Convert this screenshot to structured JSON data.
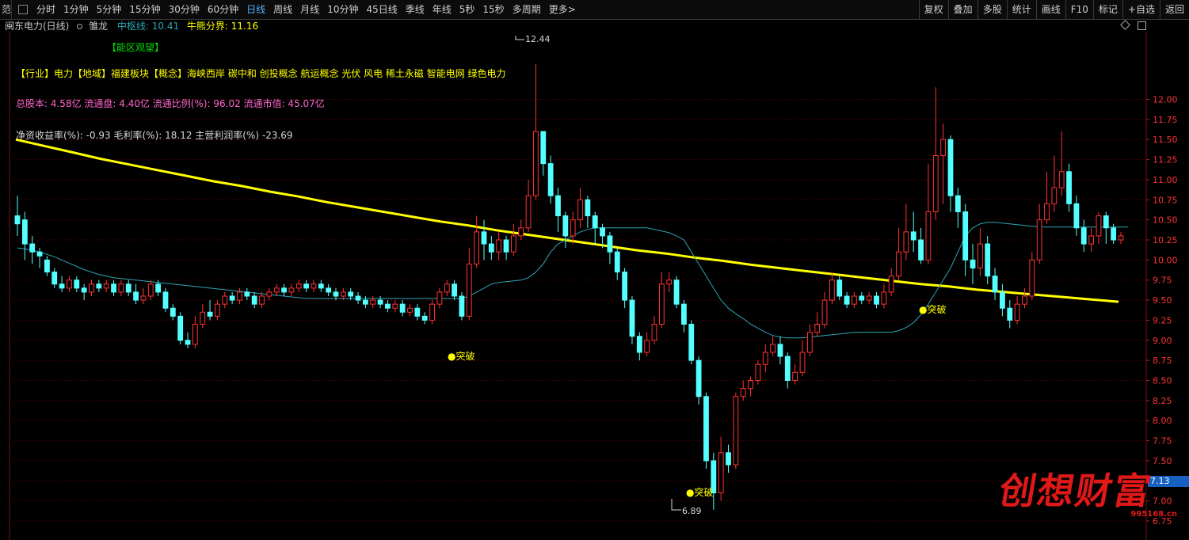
{
  "toolbar": {
    "corner": "范",
    "tabs": [
      "分时",
      "1分钟",
      "5分钟",
      "15分钟",
      "30分钟",
      "60分钟",
      "日线",
      "周线",
      "月线",
      "10分钟",
      "45日线",
      "季线",
      "年线",
      "5秒",
      "15秒",
      "多周期",
      "更多>"
    ],
    "active_tab": "日线",
    "right_buttons": [
      "复权",
      "叠加",
      "多股",
      "统计",
      "画线",
      "F10",
      "标记",
      "+自选",
      "返回"
    ]
  },
  "info": {
    "stock": "闽东电力(日线)",
    "indicator": "雏龙",
    "mid_line": "中枢线: 10.41",
    "bull_bear": "牛熊分界: 11.16"
  },
  "annotations": {
    "energy_zone": "【能区观望】",
    "industry": "【行业】电力【地域】福建板块【概念】海峡西岸 碳中和 创投概念 航运概念 光伏 风电 稀土永磁 智能电网 绿色电力",
    "capital": "总股本: 4.58亿 流通盘: 4.40亿 流通比例(%): 96.02 流通市值: 45.07亿",
    "finance": "净资收益率(%): -0.93 毛利率(%): 18.12 主营利润率(%) -23.69",
    "breakouts": [
      "●突破",
      "●突破",
      "●突破"
    ],
    "high_label": "12.44",
    "low_label": "6.89"
  },
  "last_price": "7.13",
  "watermark": {
    "title": "创想财富",
    "url": "995168.cn"
  },
  "colors": {
    "up": "#ff3232",
    "down": "#54ffff",
    "ma": "#2aa6b4",
    "bull_line": "#ffff00",
    "grid": "#7a0000"
  },
  "chart_data": {
    "type": "candlestick",
    "ylim": [
      6.75,
      12.35
    ],
    "yticks": [
      "12.00",
      "11.75",
      "11.50",
      "11.25",
      "11.00",
      "10.75",
      "10.50",
      "10.25",
      "10.00",
      "9.75",
      "9.50",
      "9.25",
      "9.00",
      "8.75",
      "8.50",
      "8.25",
      "8.00",
      "7.75",
      "7.50",
      "7.25",
      "7.00",
      "6.75"
    ],
    "bull_bear_line": [
      11.5,
      11.42,
      11.34,
      11.26,
      11.19,
      11.12,
      11.05,
      10.98,
      10.92,
      10.85,
      10.79,
      10.72,
      10.66,
      10.6,
      10.54,
      10.48,
      10.43,
      10.37,
      10.32,
      10.27,
      10.22,
      10.17,
      10.12,
      10.08,
      10.03,
      9.99,
      9.94,
      9.9,
      9.86,
      9.82,
      9.78,
      9.74,
      9.7,
      9.67,
      9.63,
      9.6,
      9.57,
      9.54,
      9.51,
      9.48
    ],
    "candles": [
      [
        10.55,
        10.45,
        10.8,
        10.3
      ],
      [
        10.5,
        10.2,
        10.6,
        10.0
      ],
      [
        10.2,
        10.1,
        10.3,
        9.95
      ],
      [
        10.1,
        10.05,
        10.15,
        9.9
      ],
      [
        10.0,
        9.85,
        10.05,
        9.8
      ],
      [
        9.85,
        9.7,
        9.9,
        9.65
      ],
      [
        9.7,
        9.65,
        9.8,
        9.6
      ],
      [
        9.65,
        9.75,
        9.8,
        9.6
      ],
      [
        9.75,
        9.65,
        9.8,
        9.6
      ],
      [
        9.65,
        9.6,
        9.7,
        9.5
      ],
      [
        9.6,
        9.7,
        9.75,
        9.55
      ],
      [
        9.7,
        9.65,
        9.75,
        9.6
      ],
      [
        9.65,
        9.7,
        9.75,
        9.6
      ],
      [
        9.7,
        9.6,
        9.75,
        9.55
      ],
      [
        9.6,
        9.7,
        9.75,
        9.55
      ],
      [
        9.7,
        9.6,
        9.75,
        9.55
      ],
      [
        9.6,
        9.5,
        9.7,
        9.45
      ],
      [
        9.5,
        9.55,
        9.65,
        9.45
      ],
      [
        9.55,
        9.7,
        9.75,
        9.5
      ],
      [
        9.7,
        9.6,
        9.75,
        9.55
      ],
      [
        9.6,
        9.4,
        9.65,
        9.35
      ],
      [
        9.4,
        9.3,
        9.45,
        9.25
      ],
      [
        9.3,
        9.0,
        9.35,
        8.95
      ],
      [
        9.0,
        8.95,
        9.1,
        8.9
      ],
      [
        8.95,
        9.2,
        9.3,
        8.9
      ],
      [
        9.2,
        9.35,
        9.45,
        9.15
      ],
      [
        9.35,
        9.3,
        9.5,
        9.25
      ],
      [
        9.3,
        9.45,
        9.5,
        9.25
      ],
      [
        9.45,
        9.55,
        9.6,
        9.4
      ],
      [
        9.55,
        9.5,
        9.6,
        9.45
      ],
      [
        9.5,
        9.6,
        9.65,
        9.45
      ],
      [
        9.6,
        9.55,
        9.65,
        9.5
      ],
      [
        9.55,
        9.45,
        9.6,
        9.4
      ],
      [
        9.45,
        9.55,
        9.6,
        9.4
      ],
      [
        9.55,
        9.6,
        9.65,
        9.5
      ],
      [
        9.6,
        9.65,
        9.7,
        9.55
      ],
      [
        9.65,
        9.6,
        9.7,
        9.55
      ],
      [
        9.6,
        9.65,
        9.7,
        9.55
      ],
      [
        9.65,
        9.7,
        9.75,
        9.6
      ],
      [
        9.7,
        9.65,
        9.75,
        9.6
      ],
      [
        9.65,
        9.7,
        9.75,
        9.6
      ],
      [
        9.7,
        9.65,
        9.75,
        9.6
      ],
      [
        9.65,
        9.6,
        9.7,
        9.55
      ],
      [
        9.6,
        9.55,
        9.65,
        9.5
      ],
      [
        9.55,
        9.6,
        9.65,
        9.5
      ],
      [
        9.6,
        9.55,
        9.65,
        9.5
      ],
      [
        9.55,
        9.5,
        9.6,
        9.45
      ],
      [
        9.5,
        9.45,
        9.55,
        9.4
      ],
      [
        9.45,
        9.5,
        9.55,
        9.4
      ],
      [
        9.5,
        9.45,
        9.55,
        9.4
      ],
      [
        9.45,
        9.4,
        9.5,
        9.35
      ],
      [
        9.4,
        9.45,
        9.5,
        9.35
      ],
      [
        9.45,
        9.35,
        9.5,
        9.3
      ],
      [
        9.35,
        9.4,
        9.45,
        9.3
      ],
      [
        9.4,
        9.3,
        9.45,
        9.25
      ],
      [
        9.3,
        9.25,
        9.35,
        9.2
      ],
      [
        9.25,
        9.45,
        9.5,
        9.2
      ],
      [
        9.45,
        9.6,
        9.65,
        9.4
      ],
      [
        9.6,
        9.7,
        9.75,
        9.55
      ],
      [
        9.7,
        9.55,
        9.75,
        9.5
      ],
      [
        9.55,
        9.3,
        9.6,
        9.25
      ],
      [
        9.3,
        9.95,
        10.15,
        9.25
      ],
      [
        9.95,
        10.35,
        10.55,
        9.9
      ],
      [
        10.35,
        10.2,
        10.5,
        10.0
      ],
      [
        10.2,
        10.1,
        10.3,
        10.0
      ],
      [
        10.1,
        10.25,
        10.35,
        10.0
      ],
      [
        10.25,
        10.1,
        10.3,
        10.0
      ],
      [
        10.1,
        10.3,
        10.45,
        10.05
      ],
      [
        10.3,
        10.4,
        10.5,
        10.25
      ],
      [
        10.4,
        10.8,
        11.0,
        10.35
      ],
      [
        10.8,
        11.6,
        12.44,
        10.75
      ],
      [
        11.6,
        11.2,
        11.4,
        11.05
      ],
      [
        11.2,
        10.8,
        11.3,
        10.7
      ],
      [
        10.8,
        10.55,
        10.9,
        10.35
      ],
      [
        10.55,
        10.3,
        10.6,
        10.15
      ],
      [
        10.3,
        10.5,
        10.6,
        10.2
      ],
      [
        10.5,
        10.75,
        10.9,
        10.4
      ],
      [
        10.75,
        10.55,
        10.8,
        10.4
      ],
      [
        10.55,
        10.4,
        10.6,
        10.2
      ],
      [
        10.4,
        10.3,
        10.45,
        10.15
      ],
      [
        10.3,
        10.1,
        10.35,
        9.95
      ],
      [
        10.1,
        9.85,
        10.15,
        9.75
      ],
      [
        9.85,
        9.5,
        9.9,
        9.4
      ],
      [
        9.5,
        9.05,
        9.55,
        8.95
      ],
      [
        9.05,
        8.85,
        9.1,
        8.75
      ],
      [
        8.85,
        9.0,
        9.1,
        8.8
      ],
      [
        9.0,
        9.2,
        9.3,
        8.95
      ],
      [
        9.2,
        9.7,
        9.85,
        9.15
      ],
      [
        9.7,
        9.75,
        9.85,
        9.6
      ],
      [
        9.75,
        9.45,
        9.8,
        9.4
      ],
      [
        9.45,
        9.2,
        9.5,
        9.1
      ],
      [
        9.2,
        8.75,
        9.25,
        8.7
      ],
      [
        8.75,
        8.3,
        8.8,
        8.2
      ],
      [
        8.3,
        7.5,
        8.35,
        7.4
      ],
      [
        7.5,
        7.1,
        7.6,
        6.89
      ],
      [
        7.1,
        7.6,
        7.8,
        7.0
      ],
      [
        7.6,
        7.45,
        7.7,
        7.35
      ],
      [
        7.45,
        8.3,
        8.35,
        7.4
      ],
      [
        8.3,
        8.4,
        8.5,
        8.25
      ],
      [
        8.4,
        8.5,
        8.55,
        8.3
      ],
      [
        8.5,
        8.7,
        8.75,
        8.45
      ],
      [
        8.7,
        8.85,
        8.95,
        8.6
      ],
      [
        8.85,
        8.95,
        9.05,
        8.8
      ],
      [
        8.95,
        8.8,
        9.05,
        8.7
      ],
      [
        8.8,
        8.5,
        8.85,
        8.4
      ],
      [
        8.5,
        8.6,
        8.7,
        8.45
      ],
      [
        8.6,
        8.85,
        9.0,
        8.55
      ],
      [
        8.85,
        9.1,
        9.2,
        8.8
      ],
      [
        9.1,
        9.2,
        9.35,
        9.05
      ],
      [
        9.2,
        9.5,
        9.6,
        9.15
      ],
      [
        9.5,
        9.75,
        9.85,
        9.45
      ],
      [
        9.75,
        9.55,
        9.8,
        9.5
      ],
      [
        9.55,
        9.45,
        9.6,
        9.4
      ],
      [
        9.45,
        9.55,
        9.6,
        9.4
      ],
      [
        9.55,
        9.5,
        9.6,
        9.45
      ],
      [
        9.5,
        9.55,
        9.6,
        9.45
      ],
      [
        9.55,
        9.45,
        9.6,
        9.4
      ],
      [
        9.45,
        9.6,
        9.7,
        9.4
      ],
      [
        9.6,
        9.8,
        9.9,
        9.55
      ],
      [
        9.8,
        10.1,
        10.4,
        9.75
      ],
      [
        10.1,
        10.35,
        10.7,
        10.0
      ],
      [
        10.35,
        10.25,
        10.6,
        10.1
      ],
      [
        10.25,
        10.0,
        10.4,
        9.95
      ],
      [
        10.0,
        10.6,
        11.2,
        9.95
      ],
      [
        10.6,
        11.3,
        12.15,
        10.5
      ],
      [
        11.3,
        11.5,
        11.7,
        10.7
      ],
      [
        11.5,
        10.8,
        11.55,
        10.6
      ],
      [
        10.8,
        10.6,
        10.9,
        10.4
      ],
      [
        10.6,
        10.0,
        10.7,
        9.8
      ],
      [
        10.0,
        9.9,
        10.2,
        9.7
      ],
      [
        9.9,
        10.2,
        10.4,
        9.8
      ],
      [
        10.2,
        9.8,
        10.3,
        9.7
      ],
      [
        9.8,
        9.6,
        9.9,
        9.5
      ],
      [
        9.6,
        9.4,
        9.7,
        9.3
      ],
      [
        9.4,
        9.25,
        9.5,
        9.15
      ],
      [
        9.25,
        9.45,
        9.55,
        9.2
      ],
      [
        9.45,
        9.55,
        9.65,
        9.4
      ],
      [
        9.55,
        10.0,
        10.1,
        9.5
      ],
      [
        10.0,
        10.5,
        10.7,
        9.95
      ],
      [
        10.5,
        10.7,
        11.1,
        10.45
      ],
      [
        10.7,
        10.9,
        11.3,
        10.6
      ],
      [
        10.9,
        11.1,
        11.6,
        10.8
      ],
      [
        11.1,
        10.7,
        11.2,
        10.6
      ],
      [
        10.7,
        10.4,
        10.8,
        10.3
      ],
      [
        10.4,
        10.2,
        10.5,
        10.1
      ],
      [
        10.2,
        10.3,
        10.4,
        10.1
      ],
      [
        10.3,
        10.55,
        10.6,
        10.2
      ],
      [
        10.55,
        10.4,
        10.6,
        10.2
      ],
      [
        10.4,
        10.25,
        10.45,
        10.2
      ],
      [
        10.25,
        10.3,
        10.35,
        10.2
      ]
    ],
    "ma": [
      10.15,
      10.14,
      10.12,
      10.1,
      10.07,
      10.04,
      10.0,
      9.96,
      9.92,
      9.88,
      9.85,
      9.82,
      9.8,
      9.78,
      9.77,
      9.76,
      9.75,
      9.74,
      9.73,
      9.72,
      9.71,
      9.7,
      9.69,
      9.68,
      9.67,
      9.66,
      9.65,
      9.64,
      9.63,
      9.62,
      9.61,
      9.6,
      9.59,
      9.58,
      9.57,
      9.56,
      9.55,
      9.54,
      9.53,
      9.52,
      9.52,
      9.52,
      9.52,
      9.52,
      9.52,
      9.52,
      9.52,
      9.52,
      9.52,
      9.52,
      9.52,
      9.52,
      9.52,
      9.52,
      9.52,
      9.52,
      9.52,
      9.52,
      9.52,
      9.52,
      9.52,
      9.55,
      9.6,
      9.65,
      9.7,
      9.72,
      9.73,
      9.74,
      9.75,
      9.78,
      9.85,
      9.95,
      10.1,
      10.2,
      10.25,
      10.3,
      10.35,
      10.38,
      10.4,
      10.4,
      10.4,
      10.4,
      10.4,
      10.4,
      10.4,
      10.4,
      10.38,
      10.36,
      10.34,
      10.3,
      10.25,
      10.1,
      9.95,
      9.8,
      9.65,
      9.5,
      9.4,
      9.33,
      9.27,
      9.2,
      9.15,
      9.1,
      9.06,
      9.04,
      9.03,
      9.03,
      9.03,
      9.04,
      9.05,
      9.06,
      9.07,
      9.08,
      9.09,
      9.1,
      9.1,
      9.1,
      9.1,
      9.1,
      9.1,
      9.12,
      9.16,
      9.22,
      9.32,
      9.45,
      9.6,
      9.75,
      9.9,
      10.1,
      10.3,
      10.4,
      10.45,
      10.47,
      10.47,
      10.46,
      10.45,
      10.44,
      10.43,
      10.42,
      10.41,
      10.41,
      10.41,
      10.41,
      10.41,
      10.41,
      10.41,
      10.41,
      10.41,
      10.41,
      10.41,
      10.41,
      10.41
    ]
  }
}
